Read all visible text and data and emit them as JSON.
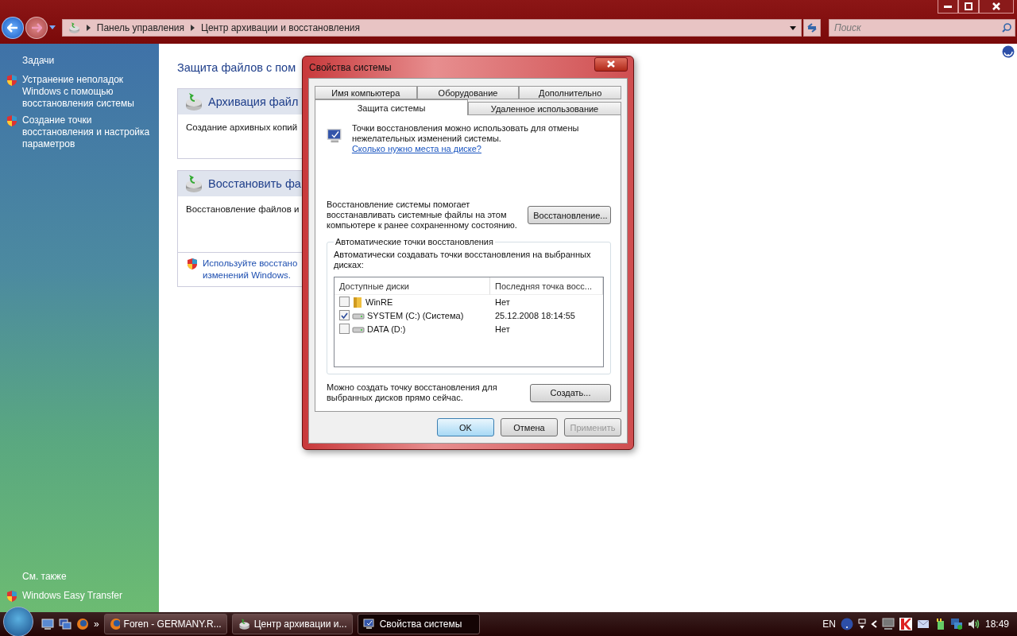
{
  "window": {
    "address": [
      "Панель управления",
      "Центр архивации и восстановления"
    ],
    "search": {
      "placeholder": "Поиск"
    }
  },
  "sidebar": {
    "tasks_title": "Задачи",
    "tasks": [
      "Устранение неполадок Windows с помощью восстановления системы",
      "Создание точки восстановления и настройка параметров"
    ],
    "see_also_title": "См. также",
    "see_also": [
      "Windows Easy Transfer"
    ]
  },
  "main": {
    "heading": "Защита файлов с пом",
    "sections": [
      {
        "title": "Архивация файл",
        "text": "Создание архивных копий"
      },
      {
        "title": "Восстановить фа",
        "text": "Восстановление файлов и",
        "note": [
          "Используйте восстано",
          "изменений Windows."
        ]
      }
    ]
  },
  "dialog": {
    "title": "Свойства системы",
    "tab_rows": [
      [
        {
          "label": "Имя компьютера",
          "selected": false
        },
        {
          "label": "Оборудование",
          "selected": false
        },
        {
          "label": "Дополнительно",
          "selected": false
        }
      ],
      [
        {
          "label": "Защита системы",
          "selected": true
        },
        {
          "label": "Удаленное использование",
          "selected": false
        }
      ]
    ],
    "intro": "Точки восстановления можно использовать для отмены нежелательных изменений системы.",
    "intro_link": "Сколько нужно места на диске?",
    "restore_text": "Восстановление системы помогает восстанавливать системные файлы на этом компьютере к ранее сохраненному состоянию.",
    "restore_button": "Восстановление...",
    "group_title": "Автоматические точки восстановления",
    "group_text": "Автоматически создавать точки восстановления на выбранных дисках:",
    "columns": [
      "Доступные диски",
      "Последняя точка восс..."
    ],
    "drives": [
      {
        "name": "WinRE",
        "kind": "folder",
        "checked": false,
        "last": "Нет"
      },
      {
        "name": "SYSTEM (C:) (Система)",
        "kind": "drive",
        "checked": true,
        "last": "25.12.2008 18:14:55"
      },
      {
        "name": "DATA (D:)",
        "kind": "drive",
        "checked": false,
        "last": "Нет"
      }
    ],
    "create_text": "Можно создать точку восстановления для выбранных дисков прямо сейчас.",
    "create_button": "Создать...",
    "buttons": [
      {
        "label": "OK",
        "kind": "default",
        "disabled": false
      },
      {
        "label": "Отмена",
        "kind": "normal",
        "disabled": false
      },
      {
        "label": "Применить",
        "kind": "normal",
        "disabled": true
      }
    ]
  },
  "taskbar": {
    "more": "»",
    "buttons": [
      {
        "label": "Foren - GERMANY.R...",
        "selected": false
      },
      {
        "label": "Центр архивации и...",
        "selected": false
      },
      {
        "label": "Свойства системы",
        "selected": true
      }
    ],
    "language": "EN",
    "clock": "18:49"
  }
}
